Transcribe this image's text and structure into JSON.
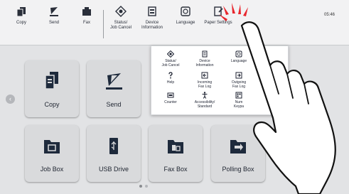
{
  "topbar": {
    "items": [
      {
        "label": "Copy",
        "icon": "copy-icon"
      },
      {
        "label": "Send",
        "icon": "send-icon"
      },
      {
        "label": "Fax",
        "icon": "fax-icon"
      },
      {
        "label": "Status/\nJob Cancel",
        "icon": "status-icon"
      },
      {
        "label": "Device\nInformation",
        "icon": "device-info-icon"
      },
      {
        "label": "Language",
        "icon": "language-icon"
      },
      {
        "label": "Paper Settings",
        "icon": "paper-settings-icon"
      }
    ],
    "time": "05:46"
  },
  "popup": {
    "items": [
      {
        "label": "Status/\nJob Cancel",
        "icon": "status-icon"
      },
      {
        "label": "Device\nInformation",
        "icon": "device-info-icon"
      },
      {
        "label": "Language",
        "icon": "language-icon"
      },
      {
        "label": "Help",
        "icon": "help-icon"
      },
      {
        "label": "Incoming\nFax Log",
        "icon": "incoming-fax-log-icon"
      },
      {
        "label": "Outgoing\nFax Log",
        "icon": "outgoing-fax-log-icon"
      },
      {
        "label": "Counter",
        "icon": "counter-icon"
      },
      {
        "label": "Accessibility/\nStandard",
        "icon": "accessibility-icon"
      },
      {
        "label": "Num\nKeypa",
        "icon": "numeric-keypad-icon"
      }
    ]
  },
  "tiles": [
    {
      "label": "Copy",
      "icon": "copy-icon"
    },
    {
      "label": "Send",
      "icon": "send-icon"
    },
    {
      "label": "Job Box",
      "icon": "job-box-icon"
    },
    {
      "label": "USB Drive",
      "icon": "usb-drive-icon"
    },
    {
      "label": "Fax Box",
      "icon": "fax-box-icon"
    },
    {
      "label": "Polling Box",
      "icon": "polling-box-icon"
    }
  ],
  "colors": {
    "accent": "#1e2a3c",
    "tap_burst": "#e8262d",
    "background": "#e2e3e5"
  }
}
